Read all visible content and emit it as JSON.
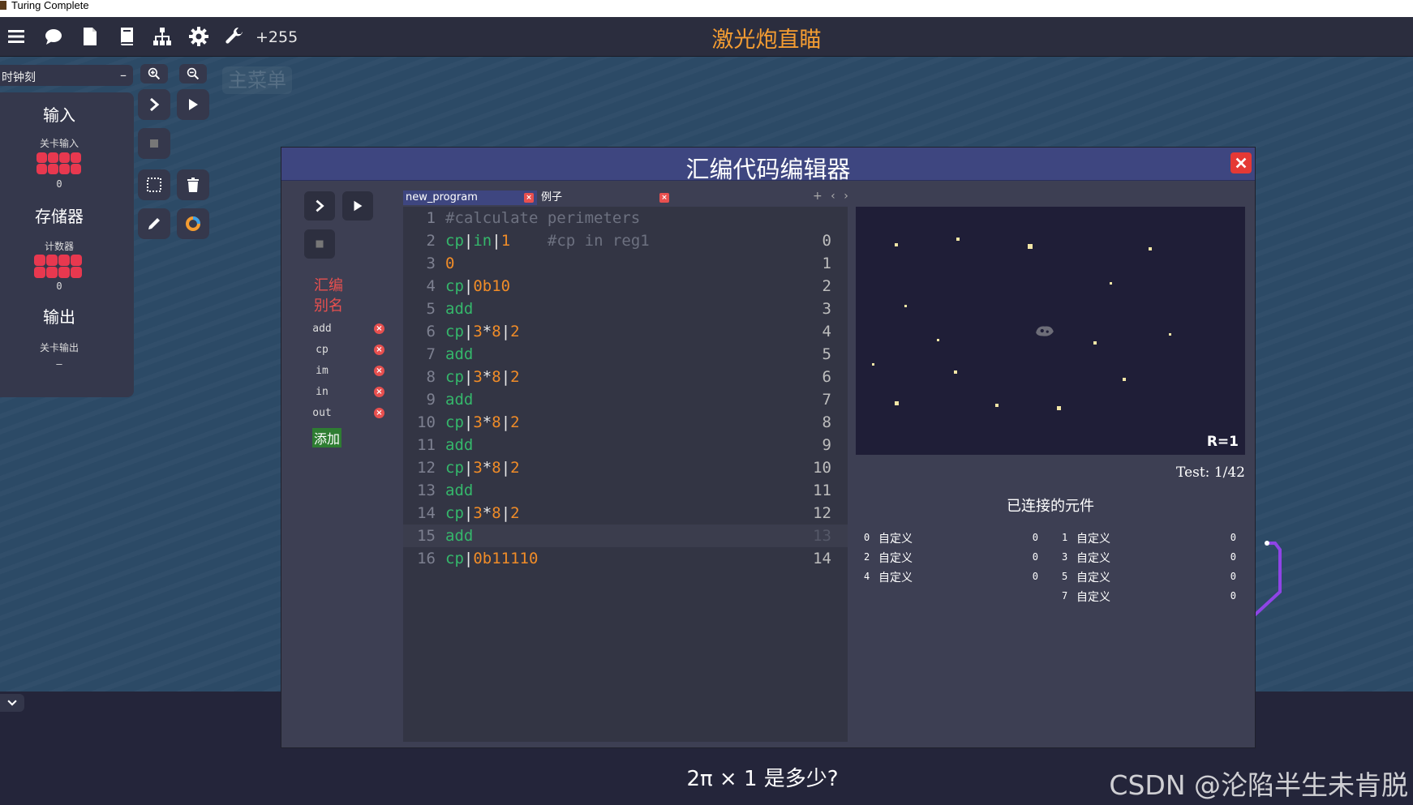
{
  "window": {
    "title": "Turing Complete"
  },
  "toolbar": {
    "icons": [
      "menu-icon",
      "chat-icon",
      "file-icon",
      "book-icon",
      "hierarchy-icon",
      "gear-icon",
      "wrench-icon"
    ],
    "score": "+255",
    "level_title": "激光炮直瞄"
  },
  "left_panel": {
    "clock_label": "时钟刻",
    "clock_toggle": "–",
    "sections": {
      "input": {
        "title": "输入",
        "component": "关卡输入",
        "value": "0"
      },
      "storage": {
        "title": "存储器",
        "component": "计数器",
        "value": "0"
      },
      "output": {
        "title": "输出",
        "component": "关卡输出",
        "value": "–"
      }
    },
    "main_menu": "主菜单"
  },
  "editor": {
    "title": "汇编代码编辑器",
    "alias_header_line1": "汇编",
    "alias_header_line2": "别名",
    "aliases": [
      "add",
      "cp",
      "im",
      "in",
      "out"
    ],
    "alias_add_label": "添加",
    "tabs": [
      {
        "label": "new_program",
        "active": true
      },
      {
        "label": "例子",
        "active": false
      }
    ],
    "tab_nav": "+ ‹ ›",
    "code_lines": [
      {
        "n": "1",
        "addr": "",
        "parts": [
          [
            "#calculate perimeters",
            "cmt"
          ]
        ]
      },
      {
        "n": "2",
        "addr": "0",
        "parts": [
          [
            "cp",
            "kw"
          ],
          [
            "|",
            "pipe"
          ],
          [
            "in",
            "kw"
          ],
          [
            "|",
            "pipe"
          ],
          [
            "1",
            "num"
          ],
          [
            "    #cp in reg1",
            "cmt"
          ]
        ]
      },
      {
        "n": "3",
        "addr": "1",
        "parts": [
          [
            "0",
            "num"
          ]
        ]
      },
      {
        "n": "4",
        "addr": "2",
        "parts": [
          [
            "cp",
            "kw"
          ],
          [
            "|",
            "pipe"
          ],
          [
            "0b10",
            "num"
          ]
        ]
      },
      {
        "n": "5",
        "addr": "3",
        "parts": [
          [
            "add",
            "kw"
          ]
        ]
      },
      {
        "n": "6",
        "addr": "4",
        "parts": [
          [
            "cp",
            "kw"
          ],
          [
            "|",
            "pipe"
          ],
          [
            "3",
            "num"
          ],
          [
            "*",
            "pipe"
          ],
          [
            "8",
            "num"
          ],
          [
            "|",
            "pipe"
          ],
          [
            "2",
            "num"
          ]
        ]
      },
      {
        "n": "7",
        "addr": "5",
        "parts": [
          [
            "add",
            "kw"
          ]
        ]
      },
      {
        "n": "8",
        "addr": "6",
        "parts": [
          [
            "cp",
            "kw"
          ],
          [
            "|",
            "pipe"
          ],
          [
            "3",
            "num"
          ],
          [
            "*",
            "pipe"
          ],
          [
            "8",
            "num"
          ],
          [
            "|",
            "pipe"
          ],
          [
            "2",
            "num"
          ]
        ]
      },
      {
        "n": "9",
        "addr": "7",
        "parts": [
          [
            "add",
            "kw"
          ]
        ]
      },
      {
        "n": "10",
        "addr": "8",
        "parts": [
          [
            "cp",
            "kw"
          ],
          [
            "|",
            "pipe"
          ],
          [
            "3",
            "num"
          ],
          [
            "*",
            "pipe"
          ],
          [
            "8",
            "num"
          ],
          [
            "|",
            "pipe"
          ],
          [
            "2",
            "num"
          ]
        ]
      },
      {
        "n": "11",
        "addr": "9",
        "parts": [
          [
            "add",
            "kw"
          ]
        ]
      },
      {
        "n": "12",
        "addr": "10",
        "parts": [
          [
            "cp",
            "kw"
          ],
          [
            "|",
            "pipe"
          ],
          [
            "3",
            "num"
          ],
          [
            "*",
            "pipe"
          ],
          [
            "8",
            "num"
          ],
          [
            "|",
            "pipe"
          ],
          [
            "2",
            "num"
          ]
        ]
      },
      {
        "n": "13",
        "addr": "11",
        "parts": [
          [
            "add",
            "kw"
          ]
        ]
      },
      {
        "n": "14",
        "addr": "12",
        "parts": [
          [
            "cp",
            "kw"
          ],
          [
            "|",
            "pipe"
          ],
          [
            "3",
            "num"
          ],
          [
            "*",
            "pipe"
          ],
          [
            "8",
            "num"
          ],
          [
            "|",
            "pipe"
          ],
          [
            "2",
            "num"
          ]
        ]
      },
      {
        "n": "15",
        "addr": "13",
        "parts": [
          [
            "add",
            "kw"
          ]
        ],
        "active": true
      },
      {
        "n": "16",
        "addr": "14",
        "parts": [
          [
            "cp",
            "kw"
          ],
          [
            "|",
            "pipe"
          ],
          [
            "0b11110",
            "num"
          ]
        ]
      }
    ],
    "screen_label": "R=1",
    "test_counter": "Test: 1/42",
    "connected_title": "已连接的元件",
    "components": [
      {
        "idx": "0",
        "name": "自定义",
        "value": "0"
      },
      {
        "idx": "1",
        "name": "自定义",
        "value": "0"
      },
      {
        "idx": "2",
        "name": "自定义",
        "value": "0"
      },
      {
        "idx": "3",
        "name": "自定义",
        "value": "0"
      },
      {
        "idx": "4",
        "name": "自定义",
        "value": "0"
      },
      {
        "idx": "5",
        "name": "自定义",
        "value": "0"
      },
      {
        "idx": "7",
        "name": "自定义",
        "value": "0"
      }
    ]
  },
  "footer": {
    "question": "2π × 1 是多少?",
    "watermark": "CSDN @沦陷半生未肯脱"
  },
  "colors": {
    "accent_orange": "#f39c32",
    "keyword_green": "#35b76b",
    "number_orange": "#f08c28",
    "alias_red": "#e8504f",
    "dot_red": "#e8384f",
    "editor_header": "#3e4680"
  }
}
